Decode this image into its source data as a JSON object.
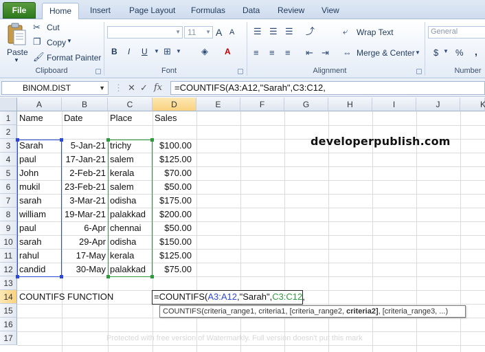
{
  "ribbon_tabs": [
    "File",
    "Home",
    "Insert",
    "Page Layout",
    "Formulas",
    "Data",
    "Review",
    "View"
  ],
  "clipboard": {
    "paste_label": "Paste",
    "cut_label": "Cut",
    "copy_label": "Copy",
    "format_painter_label": "Format Painter",
    "group_label": "Clipboard"
  },
  "font": {
    "font_size_value": "11",
    "bold_label": "B",
    "italic_label": "I",
    "underline_label": "U",
    "grow_label": "A",
    "shrink_label": "A",
    "font_color_label": "A",
    "group_label": "Font"
  },
  "alignment": {
    "wrap_text_label": "Wrap Text",
    "merge_center_label": "Merge & Center",
    "group_label": "Alignment"
  },
  "number": {
    "format_value": "General",
    "currency_label": "$",
    "percent_label": "%",
    "comma_label": ",",
    "group_label": "Number"
  },
  "formula_bar": {
    "name_box": "BINOM.DIST",
    "cancel_icon": "✕",
    "enter_icon": "✓",
    "fx_label": "fx",
    "formula": "=COUNTIFS(A3:A12,\"Sarah\",C3:C12,"
  },
  "sheet": {
    "columns": [
      "A",
      "B",
      "C",
      "D",
      "E",
      "F",
      "G",
      "H",
      "I",
      "J",
      "K"
    ],
    "rows": [
      "1",
      "2",
      "3",
      "4",
      "5",
      "6",
      "7",
      "8",
      "9",
      "10",
      "11",
      "12",
      "13",
      "14",
      "15",
      "16",
      "17"
    ],
    "headers": {
      "a": "Name",
      "b": "Date",
      "c": "Place",
      "d": "Sales"
    },
    "data": [
      {
        "name": "Sarah",
        "date": "5-Jan-21",
        "place": "trichy",
        "sales": "$100.00"
      },
      {
        "name": "paul",
        "date": "17-Jan-21",
        "place": "salem",
        "sales": "$125.00"
      },
      {
        "name": "John",
        "date": "2-Feb-21",
        "place": "kerala",
        "sales": "$70.00"
      },
      {
        "name": "mukil",
        "date": "23-Feb-21",
        "place": "salem",
        "sales": "$50.00"
      },
      {
        "name": "sarah",
        "date": "3-Mar-21",
        "place": "odisha",
        "sales": "$175.00"
      },
      {
        "name": "william",
        "date": "19-Mar-21",
        "place": "palakkad",
        "sales": "$200.00"
      },
      {
        "name": "paul",
        "date": "6-Apr",
        "place": "chennai",
        "sales": "$50.00"
      },
      {
        "name": "sarah",
        "date": "29-Apr",
        "place": "odisha",
        "sales": "$150.00"
      },
      {
        "name": "rahul",
        "date": "17-May",
        "place": "kerala",
        "sales": "$125.00"
      },
      {
        "name": "candid",
        "date": "30-May",
        "place": "palakkad",
        "sales": "$75.00"
      }
    ],
    "label_a14": "COUNTIFS FUNCTION",
    "edit_parts": {
      "p1": "=COUNTIFS(",
      "p2": "A3:A12",
      "p3": ",\"Sarah\",",
      "p4": "C3:C12",
      "p5": ","
    },
    "tooltip": {
      "before": "COUNTIFS(criteria_range1, criteria1, [criteria_range2, ",
      "bold": "criteria2]",
      "after": ", [criteria_range3, ...)"
    }
  },
  "brand_text": "developerpublish.com",
  "watermark_text": "Protected with free version of Watermarkly. Full version doesn't put this mark",
  "colors": {
    "range_a": "#2b48d6",
    "range_c": "#2d9a3c",
    "file_tab": "#2c7a1d"
  }
}
